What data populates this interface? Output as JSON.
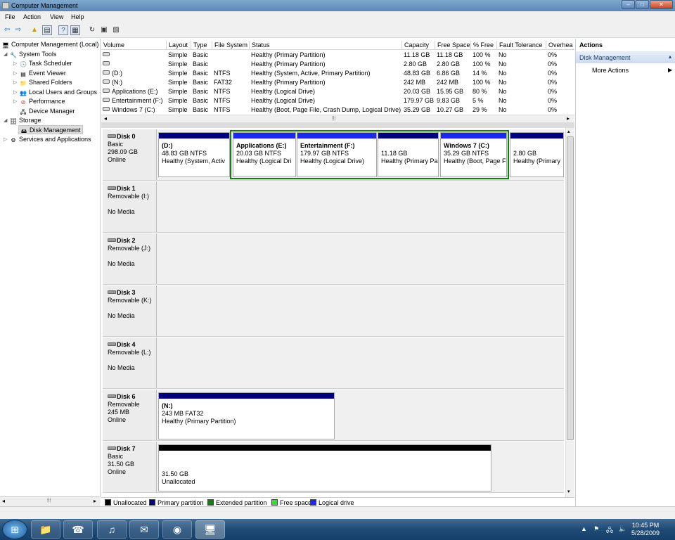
{
  "window": {
    "title": "Computer Management",
    "controls": [
      "–",
      "□",
      "✕"
    ]
  },
  "menu": [
    "File",
    "Action",
    "View",
    "Help"
  ],
  "tree": {
    "root": "Computer Management (Local)",
    "system_tools": "System Tools",
    "items": [
      "Task Scheduler",
      "Event Viewer",
      "Shared Folders",
      "Local Users and Groups",
      "Performance",
      "Device Manager"
    ],
    "storage": "Storage",
    "disk_management": "Disk Management",
    "services": "Services and Applications"
  },
  "volume_table": {
    "columns": [
      "Volume",
      "Layout",
      "Type",
      "File System",
      "Status",
      "Capacity",
      "Free Space",
      "% Free",
      "Fault Tolerance",
      "Overhea"
    ],
    "rows": [
      [
        "",
        "Simple",
        "Basic",
        "",
        "Healthy (Primary Partition)",
        "11.18 GB",
        "11.18 GB",
        "100 %",
        "No",
        "0%"
      ],
      [
        "",
        "Simple",
        "Basic",
        "",
        "Healthy (Primary Partition)",
        "2.80 GB",
        "2.80 GB",
        "100 %",
        "No",
        "0%"
      ],
      [
        "(D:)",
        "Simple",
        "Basic",
        "NTFS",
        "Healthy (System, Active, Primary Partition)",
        "48.83 GB",
        "6.86 GB",
        "14 %",
        "No",
        "0%"
      ],
      [
        "(N:)",
        "Simple",
        "Basic",
        "FAT32",
        "Healthy (Primary Partition)",
        "242 MB",
        "242 MB",
        "100 %",
        "No",
        "0%"
      ],
      [
        "Applications (E:)",
        "Simple",
        "Basic",
        "NTFS",
        "Healthy (Logical Drive)",
        "20.03 GB",
        "15.95 GB",
        "80 %",
        "No",
        "0%"
      ],
      [
        "Entertainment (F:)",
        "Simple",
        "Basic",
        "NTFS",
        "Healthy (Logical Drive)",
        "179.97 GB",
        "9.83 GB",
        "5 %",
        "No",
        "0%"
      ],
      [
        "Windows 7 (C:)",
        "Simple",
        "Basic",
        "NTFS",
        "Healthy (Boot, Page File, Crash Dump, Logical Drive)",
        "35.29 GB",
        "10.27 GB",
        "29 %",
        "No",
        "0%"
      ]
    ]
  },
  "disks": [
    {
      "name": "Disk 0",
      "type": "Basic",
      "size": "298.09 GB",
      "status": "Online",
      "partitions": [
        {
          "title": "(D:)",
          "size": "48.83 GB NTFS",
          "status": "Healthy (System, Activ"
        },
        {
          "title": "Applications  (E:)",
          "size": "20.03 GB NTFS",
          "status": "Healthy (Logical Dri"
        },
        {
          "title": "Entertainment  (F:)",
          "size": "179.97 GB NTFS",
          "status": "Healthy (Logical Drive)"
        },
        {
          "title": "",
          "size": "11.18 GB",
          "status": "Healthy (Primary Pa"
        },
        {
          "title": "Windows 7  (C:)",
          "size": "35.29 GB NTFS",
          "status": "Healthy (Boot, Page F"
        },
        {
          "title": "",
          "size": "2.80 GB",
          "status": "Healthy (Primary"
        }
      ]
    },
    {
      "name": "Disk 1",
      "type": "Removable (I:)",
      "media": "No Media"
    },
    {
      "name": "Disk 2",
      "type": "Removable (J:)",
      "media": "No Media"
    },
    {
      "name": "Disk 3",
      "type": "Removable (K:)",
      "media": "No Media"
    },
    {
      "name": "Disk 4",
      "type": "Removable (L:)",
      "media": "No Media"
    },
    {
      "name": "Disk 6",
      "type": "Removable",
      "size": "245 MB",
      "status": "Online",
      "partitions": [
        {
          "title": "(N:)",
          "size": "243 MB FAT32",
          "status": "Healthy (Primary Partition)"
        }
      ]
    },
    {
      "name": "Disk 7",
      "type": "Basic",
      "size": "31.50 GB",
      "status": "Online",
      "partitions": [
        {
          "title": "",
          "size": "31.50 GB",
          "status": "Unallocated"
        }
      ]
    }
  ],
  "legend": [
    {
      "label": "Unallocated",
      "color": "#000000"
    },
    {
      "label": "Primary partition",
      "color": "#00007f"
    },
    {
      "label": "Extended partition",
      "color": "#1b7a1b"
    },
    {
      "label": "Free space",
      "color": "#33dd33"
    },
    {
      "label": "Logical drive",
      "color": "#1f28e6"
    }
  ],
  "actions": {
    "title": "Actions",
    "section": "Disk Management",
    "more": "More Actions"
  },
  "taskbar": {
    "time": "10:45 PM",
    "date": "5/28/2009"
  }
}
